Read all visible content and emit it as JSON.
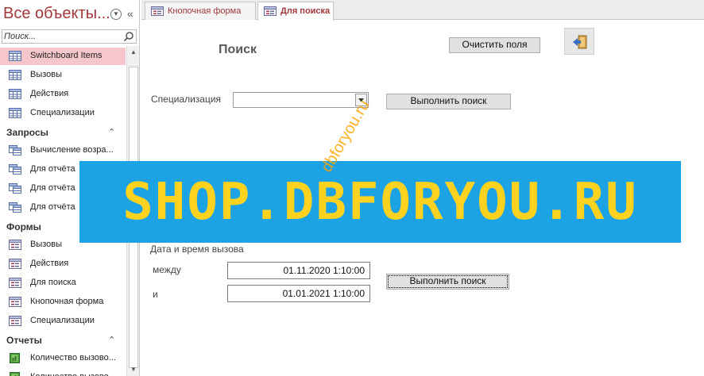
{
  "nav": {
    "title": "Все объекты...",
    "search_placeholder": "Поиск...",
    "items": [
      {
        "type": "table",
        "label": "Switchboard Items",
        "selected": true
      },
      {
        "type": "table",
        "label": "Вызовы"
      },
      {
        "type": "table",
        "label": "Действия"
      },
      {
        "type": "table",
        "label": "Специализации"
      },
      {
        "type": "group",
        "label": "Запросы"
      },
      {
        "type": "query",
        "label": "Вычисление возра..."
      },
      {
        "type": "query",
        "label": "Для отчёта"
      },
      {
        "type": "query",
        "label": "Для отчёта"
      },
      {
        "type": "query",
        "label": "Для отчёта"
      },
      {
        "type": "group",
        "label": "Формы"
      },
      {
        "type": "form",
        "label": "Вызовы"
      },
      {
        "type": "form",
        "label": "Действия"
      },
      {
        "type": "form",
        "label": "Для поиска"
      },
      {
        "type": "form",
        "label": "Кнопочная форма"
      },
      {
        "type": "form",
        "label": "Специализации"
      },
      {
        "type": "group",
        "label": "Отчеты"
      },
      {
        "type": "report",
        "label": "Количество вызово..."
      },
      {
        "type": "report",
        "label": "Количество вызово..."
      }
    ]
  },
  "tabs": [
    {
      "label": "Кнопочная форма",
      "active": false
    },
    {
      "label": "Для поиска",
      "active": true
    }
  ],
  "form": {
    "title": "Поиск",
    "clear_button": "Очистить поля",
    "spec_label": "Специализация",
    "spec_value": "",
    "search_button_1": "Выполнить поиск",
    "datetime_label": "Дата и время вызова",
    "between_label": "между",
    "and_label": "и",
    "date_from": "01.11.2020 1:10:00",
    "date_to": "01.01.2021 1:10:00",
    "search_button_2": "Выполнить поиск"
  },
  "watermark": {
    "banner_text": "SHOP.DBFORYOU.RU",
    "diagonal_text": "dbforyou.ru"
  },
  "colors": {
    "accent": "#a4373a",
    "selected_bg": "#f5c6cb",
    "banner_bg": "#1ca3e6",
    "banner_text": "#ffd21f"
  }
}
